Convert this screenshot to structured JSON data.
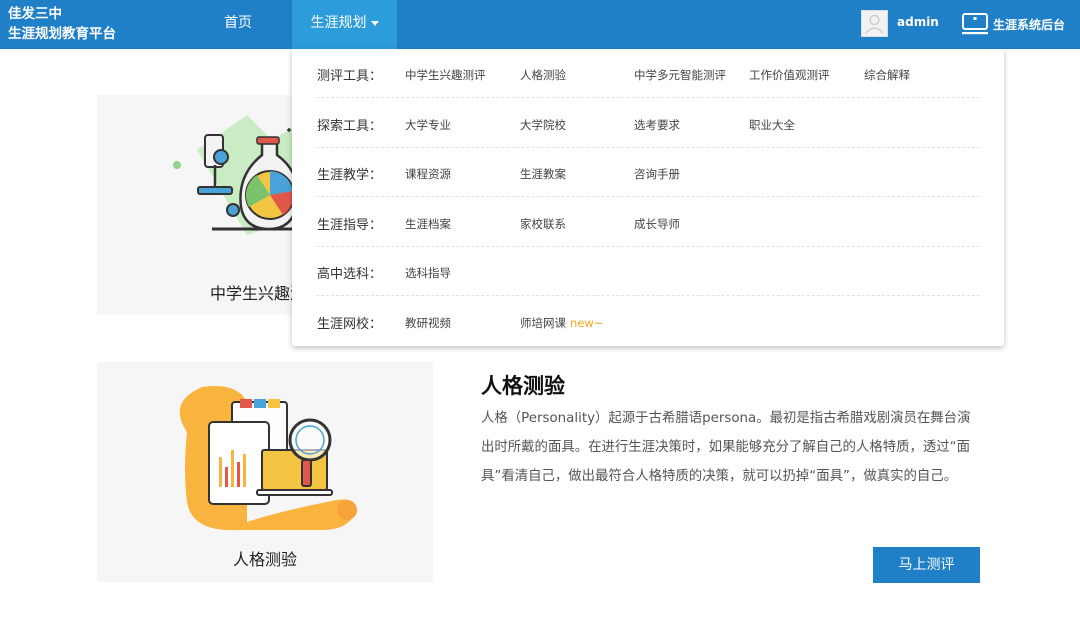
{
  "header": {
    "brand_line1": "佳发三中",
    "brand_line2": "生涯规划教育平台",
    "nav_home": "首页",
    "nav_career": "生涯规划",
    "username": "admin",
    "backend_label": "生涯系统后台"
  },
  "menu": {
    "rows": [
      {
        "label": "测评工具：",
        "items": [
          "中学生兴趣测评",
          "人格测验",
          "中学多元智能测评",
          "工作价值观测评",
          "综合解释"
        ]
      },
      {
        "label": "探索工具：",
        "items": [
          "大学专业",
          "大学院校",
          "选考要求",
          "职业大全"
        ]
      },
      {
        "label": "生涯教学：",
        "items": [
          "课程资源",
          "生涯教案",
          "咨询手册"
        ]
      },
      {
        "label": "生涯指导：",
        "items": [
          "生涯档案",
          "家校联系",
          "成长导师"
        ]
      },
      {
        "label": "高中选科：",
        "items": [
          "选科指导"
        ]
      },
      {
        "label": "生涯网校：",
        "items": [
          "教研视频",
          "师培网课"
        ]
      }
    ],
    "new_tag": "new~"
  },
  "cards": {
    "card1_caption": "中学生兴趣测",
    "card2_caption": "人格测验"
  },
  "detail": {
    "title": "人格测验",
    "description": "人格（Personality）起源于古希腊语persona。最初是指古希腊戏剧演员在舞台演出时所戴的面具。在进行生涯决策时，如果能够充分了解自己的人格特质，透过“面具”看清自己，做出最符合人格特质的决策，就可以扔掉“面具”，做真实的自己。",
    "start_button": "马上测评"
  },
  "colors": {
    "primary": "#1f7fc7",
    "nav_active": "#2d9cdb",
    "new_tag": "#f5a623"
  }
}
